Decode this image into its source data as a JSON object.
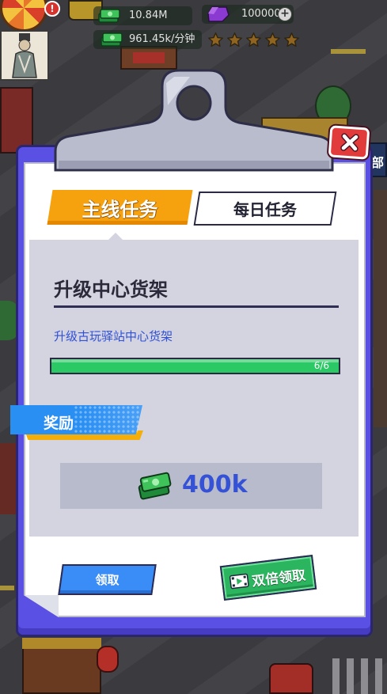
{
  "hud": {
    "alert_badge": "!",
    "cash": "10.84M",
    "gems": "100000",
    "gem_add_glyph": "+",
    "income_rate": "961.45k/分钟",
    "rating_stars": {
      "total": 5
    }
  },
  "background": {
    "side_sign_text": "部"
  },
  "modal": {
    "tabs": [
      {
        "label": "主线任务",
        "active": true
      },
      {
        "label": "每日任务",
        "active": false
      }
    ],
    "task": {
      "title": "升级中心货架",
      "description": "升级古玩驿站中心货架",
      "progress": {
        "current": 6,
        "total": 6,
        "label": "6/6"
      }
    },
    "reward": {
      "label": "奖励",
      "amount": "400k",
      "icon": "cash-icon"
    },
    "buttons": {
      "claim": "领取",
      "double_claim": "双倍领取",
      "double_claim_icon": "video-icon",
      "close_icon": "close-icon"
    }
  },
  "colors": {
    "frame": "#5b50e4",
    "active_tab": "#f6a20e",
    "progress_green": "#2bc866",
    "reward_text": "#3552d6",
    "claim_button": "#3a8cf6",
    "double_claim_button": "#2ab55e",
    "close_button": "#e23b3b",
    "star": "#8f6420"
  }
}
